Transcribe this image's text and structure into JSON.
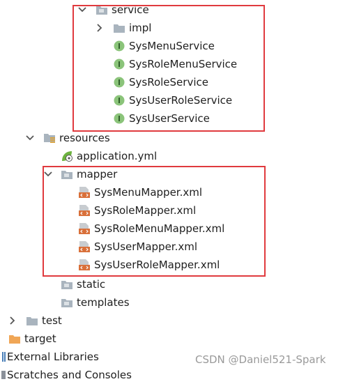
{
  "tree": {
    "service": "service",
    "impl": "impl",
    "sys_menu_service": "SysMenuService",
    "sys_role_menu_service": "SysRoleMenuService",
    "sys_role_service": "SysRoleService",
    "sys_user_role_service": "SysUserRoleService",
    "sys_user_service": "SysUserService",
    "resources": "resources",
    "application_yml": "application.yml",
    "mapper": "mapper",
    "sys_menu_mapper": "SysMenuMapper.xml",
    "sys_role_mapper": "SysRoleMapper.xml",
    "sys_role_menu_mapper": "SysRoleMenuMapper.xml",
    "sys_user_mapper": "SysUserMapper.xml",
    "sys_user_role_mapper": "SysUserRoleMapper.xml",
    "static": "static",
    "templates": "templates",
    "test": "test",
    "target": "target",
    "external_libraries": "External Libraries",
    "scratches": "Scratches and Consoles"
  },
  "watermark": "CSDN @Daniel521-Spark",
  "colors": {
    "highlight_box": "#e03a3e",
    "interface_icon": "#8bc47a",
    "folder_icon": "#a9b4be",
    "target_folder": "#f0a656",
    "xml_icon": "#d9703a"
  },
  "icons": {
    "expanded": "chevron-down-icon",
    "collapsed": "chevron-right-icon",
    "folder": "folder-icon",
    "interface": "interface-icon",
    "xml": "xml-file-icon",
    "yaml": "spring-config-icon"
  }
}
